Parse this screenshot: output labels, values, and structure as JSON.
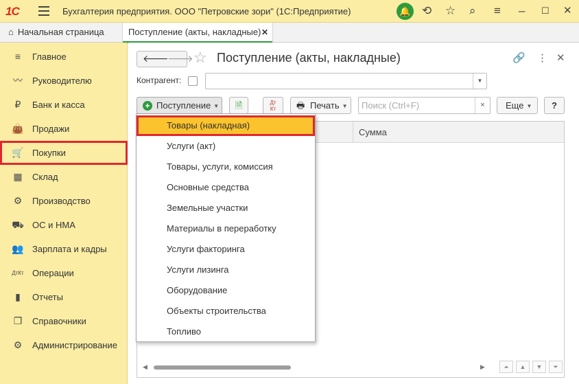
{
  "titlebar": {
    "logo": "1С",
    "title": "Бухгалтерия предприятия. ООО \"Петровские зори\"  (1С:Предприятие)",
    "icons": [
      "menu-icon",
      "bell-icon",
      "history-icon",
      "star-icon",
      "search-icon",
      "minimize-icon",
      "maximize-icon",
      "close-icon"
    ]
  },
  "tabs": {
    "home": "Начальная страница",
    "doc": "Поступление (акты, накладные)",
    "close": "✕"
  },
  "sidebar": {
    "items": [
      {
        "label": "Главное",
        "icon": "≡"
      },
      {
        "label": "Руководителю",
        "icon": "〰"
      },
      {
        "label": "Банк и касса",
        "icon": "₽"
      },
      {
        "label": "Продажи",
        "icon": "👜"
      },
      {
        "label": "Покупки",
        "icon": "🛒"
      },
      {
        "label": "Склад",
        "icon": "▦"
      },
      {
        "label": "Производство",
        "icon": "⚙"
      },
      {
        "label": "ОС и НМА",
        "icon": "⛟"
      },
      {
        "label": "Зарплата и кадры",
        "icon": "👥"
      },
      {
        "label": "Операции",
        "icon": "ДтКт"
      },
      {
        "label": "Отчеты",
        "icon": "▮"
      },
      {
        "label": "Справочники",
        "icon": "❐"
      },
      {
        "label": "Администрирование",
        "icon": "⚙"
      }
    ],
    "active_index": 4
  },
  "form": {
    "title": "Поступление (акты, накладные)",
    "contractor_label": "Контрагент:",
    "contractor_value": "",
    "buttons": {
      "postuplenie": "Поступление",
      "print": "Печать",
      "more": "Еще",
      "help": "?",
      "dtkt": "Дт\nКт"
    },
    "search_placeholder": "Поиск (Ctrl+F)",
    "search_clear": "×",
    "column_summa": "Сумма"
  },
  "dropdown": {
    "items": [
      "Товары (накладная)",
      "Услуги (акт)",
      "Товары, услуги, комиссия",
      "Основные средства",
      "Земельные участки",
      "Материалы в переработку",
      "Услуги факторинга",
      "Услуги лизинга",
      "Оборудование",
      "Объекты строительства",
      "Топливо"
    ],
    "highlighted_index": 0
  },
  "colors": {
    "sidebar_bg": "#fbeda4",
    "highlight": "#fbc32e",
    "red_frame": "#e0282e",
    "green": "#2e9b3f"
  }
}
